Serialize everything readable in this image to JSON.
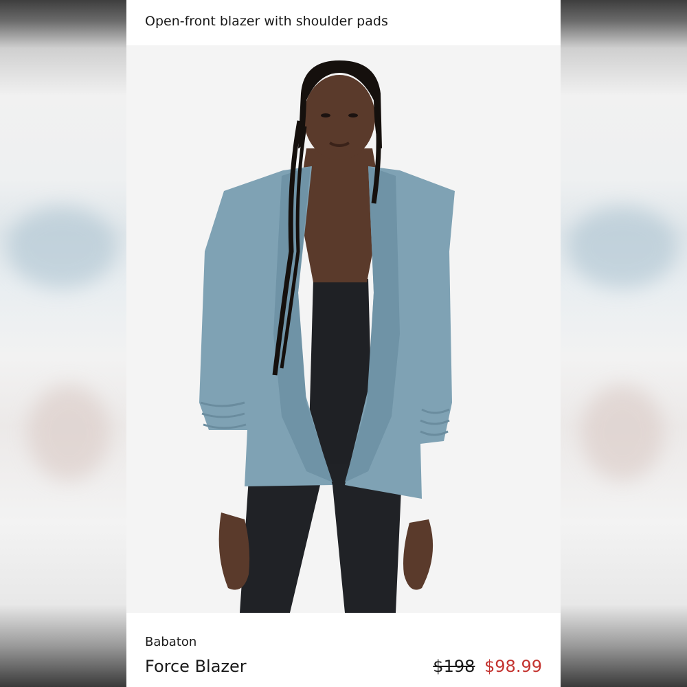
{
  "listing": {
    "title": "Open-front blazer with shoulder pads",
    "brand": "Babaton",
    "product_name": "Force Blazer",
    "original_price": "$198",
    "sale_price": "$98.99"
  },
  "colors": {
    "sale_price": "#c4332f",
    "blazer": "#7fa2b4",
    "background": "#f4f4f4"
  }
}
